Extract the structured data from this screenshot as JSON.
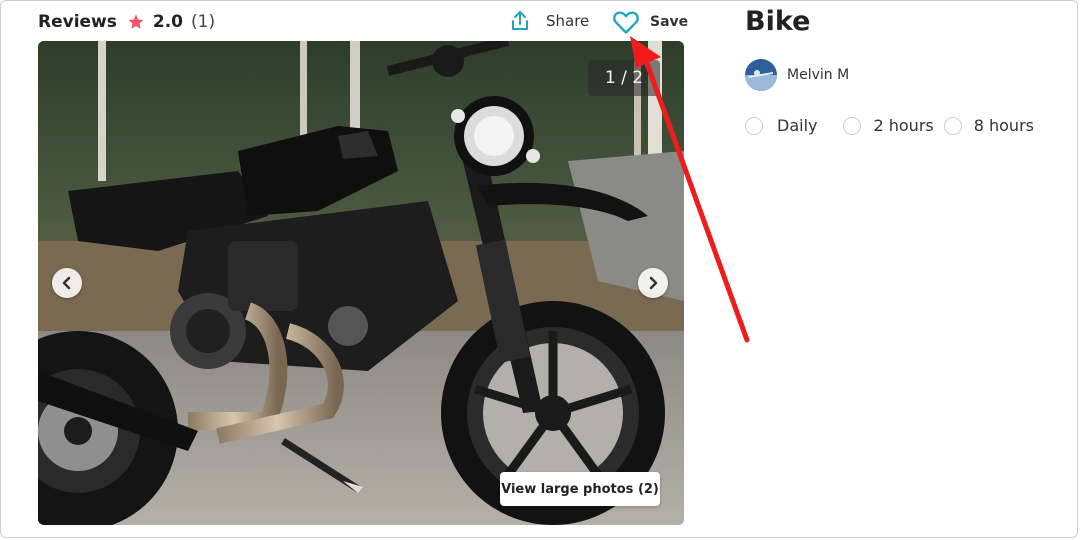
{
  "reviews": {
    "title": "Reviews",
    "rating": "2.0",
    "count": "(1)"
  },
  "actions": {
    "share_label": "Share",
    "save_label": "Save"
  },
  "gallery": {
    "counter": "1 / 2",
    "view_large_label": "View large photos (2)"
  },
  "listing": {
    "title": "Bike",
    "owner_name": "Melvin M"
  },
  "rental_options": [
    {
      "label": "Daily"
    },
    {
      "label": "2 hours"
    },
    {
      "label": "8 hours"
    }
  ],
  "colors": {
    "star": "#f0566a",
    "heart": "#1fa6bd",
    "share_icon": "#1fa6bd",
    "annotation_arrow": "#ee1c1c"
  },
  "icons": {
    "star": "star-icon",
    "share": "share-icon",
    "save": "heart-icon",
    "prev": "chevron-left-icon",
    "next": "chevron-right-icon"
  }
}
